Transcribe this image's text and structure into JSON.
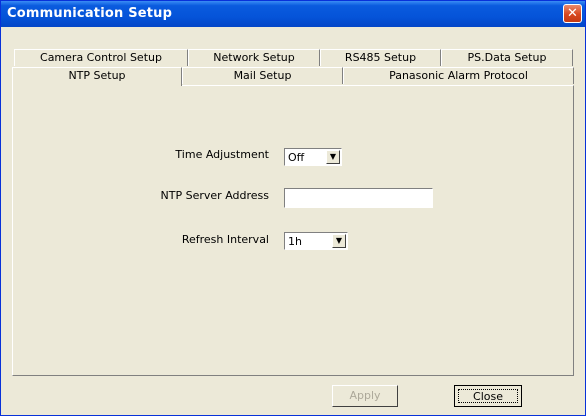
{
  "window": {
    "title": "Communication Setup",
    "close_glyph": "✕"
  },
  "tabs_row1": [
    {
      "label": "Camera Control Setup"
    },
    {
      "label": "Network Setup"
    },
    {
      "label": "RS485 Setup"
    },
    {
      "label": "PS.Data Setup"
    }
  ],
  "tabs_row2": [
    {
      "label": "NTP Setup",
      "active": true
    },
    {
      "label": "Mail Setup"
    },
    {
      "label": "Panasonic Alarm Protocol"
    }
  ],
  "form": {
    "time_adjustment": {
      "label": "Time Adjustment",
      "value": "Off"
    },
    "ntp_server": {
      "label": "NTP Server Address",
      "value": ""
    },
    "refresh_interval": {
      "label": "Refresh Interval",
      "value": "1h"
    }
  },
  "buttons": {
    "apply": "Apply",
    "close": "Close"
  },
  "icons": {
    "dropdown": "chevron-down-icon",
    "close": "close-icon"
  }
}
